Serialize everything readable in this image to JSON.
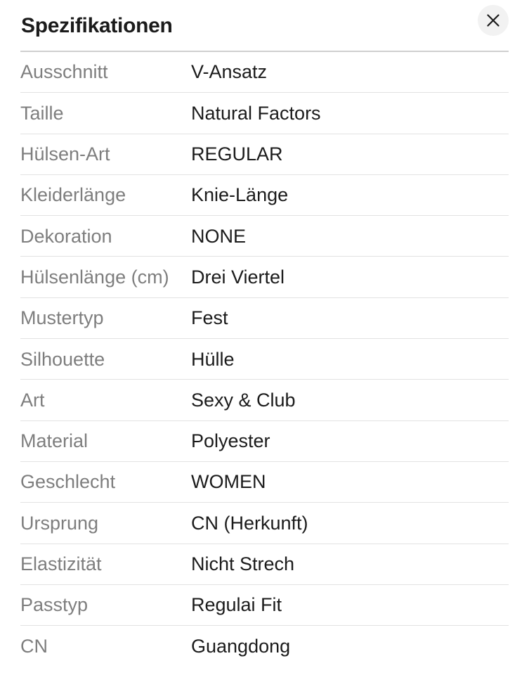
{
  "modal": {
    "title": "Spezifikationen",
    "close_icon": "close-icon",
    "close_label": "Schließen"
  },
  "colors": {
    "background": "#ffffff",
    "title_text": "#1b1b1b",
    "label_text": "#7e7e7e",
    "value_text": "#1b1b1b",
    "header_rule": "#cfcfcf",
    "row_divider": "#e2e2e2",
    "close_button_bg": "#f2f2f2"
  },
  "specs": [
    {
      "label": "Ausschnitt",
      "value": "V-Ansatz"
    },
    {
      "label": "Taille",
      "value": "Natural Factors"
    },
    {
      "label": "Hülsen-Art",
      "value": "REGULAR"
    },
    {
      "label": "Kleiderlänge",
      "value": "Knie-Länge"
    },
    {
      "label": "Dekoration",
      "value": "NONE"
    },
    {
      "label": "Hülsenlänge (cm)",
      "value": "Drei Viertel"
    },
    {
      "label": "Mustertyp",
      "value": "Fest"
    },
    {
      "label": "Silhouette",
      "value": "Hülle"
    },
    {
      "label": "Art",
      "value": "Sexy & Club"
    },
    {
      "label": "Material",
      "value": "Polyester"
    },
    {
      "label": "Geschlecht",
      "value": "WOMEN"
    },
    {
      "label": "Ursprung",
      "value": "CN (Herkunft)"
    },
    {
      "label": "Elastizität",
      "value": "Nicht Strech"
    },
    {
      "label": "Passtyp",
      "value": "Regulai Fit"
    },
    {
      "label": "CN",
      "value": "Guangdong"
    }
  ]
}
